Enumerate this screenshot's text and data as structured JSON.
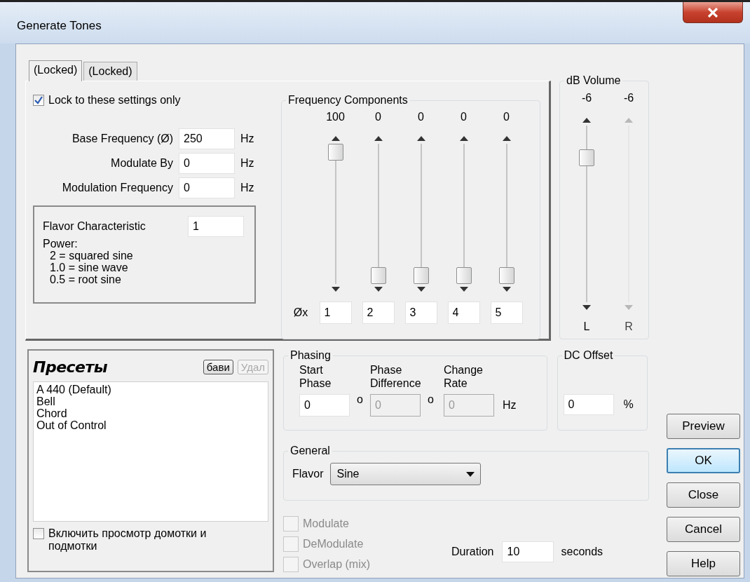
{
  "window": {
    "title": "Generate Tones"
  },
  "tabs": [
    {
      "label": "(Locked)",
      "selected": true
    },
    {
      "label": "(Locked)",
      "selected": false
    }
  ],
  "lock_checkbox": {
    "label": "Lock to these settings only",
    "checked": true
  },
  "fields": [
    {
      "label": "Base Frequency (Ø)",
      "value": "250",
      "unit": "Hz"
    },
    {
      "label": "Modulate By",
      "value": "0",
      "unit": "Hz"
    },
    {
      "label": "Modulation Frequency",
      "value": "0",
      "unit": "Hz"
    }
  ],
  "flavor_box": {
    "label": "Flavor Characteristic",
    "value": "1",
    "notes": [
      "Power:",
      "2 = squared sine",
      "1.0 = sine wave",
      "0.5 = root sine"
    ]
  },
  "frequency_components": {
    "title": "Frequency Components",
    "multiplier_label": "Øx",
    "sliders": [
      {
        "reading": "100",
        "level": 1,
        "multiplier": "1"
      },
      {
        "reading": "0",
        "level": 0,
        "multiplier": "2"
      },
      {
        "reading": "0",
        "level": 0,
        "multiplier": "3"
      },
      {
        "reading": "0",
        "level": 0,
        "multiplier": "4"
      },
      {
        "reading": "0",
        "level": 0,
        "multiplier": "5"
      }
    ]
  },
  "volume": {
    "title": "dB Volume",
    "channels": [
      {
        "reading": "-6",
        "label": "L",
        "disabled": false,
        "level": 0.85
      },
      {
        "reading": "-6",
        "label": "R",
        "disabled": true
      }
    ]
  },
  "presets": {
    "title": "Пресеты",
    "buttons": [
      {
        "label": "бави",
        "disabled": false
      },
      {
        "label": "Удал",
        "disabled": true
      }
    ],
    "items": [
      {
        "label": "A 440 (Default)",
        "selected": false
      },
      {
        "label": "Bell",
        "selected": false
      },
      {
        "label": "Chord",
        "selected": false
      },
      {
        "label": "Out of Control",
        "selected": false
      }
    ],
    "checkbox": {
      "label": "Включить просмотр домотки и подмотки",
      "checked": false
    }
  },
  "phasing": {
    "title": "Phasing",
    "fields": [
      {
        "label": "Start Phase",
        "value": "0",
        "unit": "o",
        "disabled": false
      },
      {
        "label": "Phase Difference",
        "value": "0",
        "unit": "o",
        "disabled": true
      },
      {
        "label": "Change Rate",
        "value": "0",
        "unit": "Hz",
        "disabled": true
      }
    ]
  },
  "dc_offset": {
    "title": "DC Offset",
    "value": "0",
    "unit": "%"
  },
  "general": {
    "title": "General",
    "flavor_label": "Flavor",
    "flavor_value": "Sine"
  },
  "options": [
    {
      "label": "Modulate",
      "checked": false,
      "disabled": true
    },
    {
      "label": "DeModulate",
      "checked": false,
      "disabled": true
    },
    {
      "label": "Overlap (mix)",
      "checked": false,
      "disabled": true
    }
  ],
  "duration": {
    "label": "Duration",
    "value": "10",
    "unit": "seconds"
  },
  "buttons": [
    {
      "label": "Preview",
      "default": false
    },
    {
      "label": "OK",
      "default": true
    },
    {
      "label": "Close",
      "default": false
    },
    {
      "label": "Cancel",
      "default": false
    },
    {
      "label": "Help",
      "default": false
    }
  ]
}
